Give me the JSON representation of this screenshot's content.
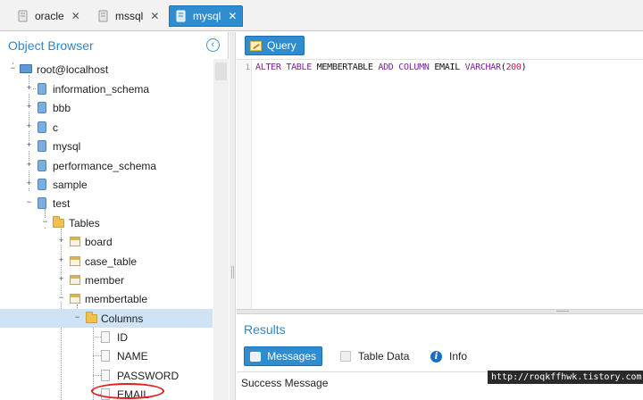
{
  "tabs": [
    {
      "label": "oracle",
      "close": "✕",
      "active": false
    },
    {
      "label": "mssql",
      "close": "✕",
      "active": false
    },
    {
      "label": "mysql",
      "close": "✕",
      "active": true
    }
  ],
  "object_browser": {
    "title": "Object Browser",
    "collapse_icon": "chevron-left-circle-icon",
    "root": "root@localhost",
    "databases": [
      "information_schema",
      "bbb",
      "c",
      "mysql",
      "performance_schema",
      "sample",
      "test"
    ],
    "tables_folder": "Tables",
    "tables": [
      "board",
      "case_table",
      "member",
      "membertable"
    ],
    "columns_folder": "Columns",
    "columns": [
      "ID",
      "NAME",
      "PASSWORD",
      "EMAIL"
    ],
    "selected_item": "Columns",
    "highlighted_item": "EMAIL"
  },
  "query": {
    "button_label": "Query",
    "line_number": "1",
    "sql_tokens": {
      "t1": "ALTER",
      "t2": "TABLE",
      "t3": "MEMBERTABLE",
      "t4": "ADD",
      "t5": "COLUMN",
      "t6": "EMAIL",
      "t7": "VARCHAR",
      "t8": "(",
      "t9": "200",
      "t10": ")"
    }
  },
  "results": {
    "title": "Results",
    "tabs": [
      {
        "label": "Messages",
        "active": true
      },
      {
        "label": "Table Data",
        "active": false
      },
      {
        "label": "Info",
        "active": false
      }
    ],
    "message": "Success Message"
  },
  "watermark": "http://roqkffhwk.tistory.com",
  "colors": {
    "accent": "#2e8ccf",
    "title_blue": "#2f86cc",
    "selection": "#cfe3f5",
    "annotation_red": "#e02020",
    "sql_keyword": "#7a1fa2"
  }
}
